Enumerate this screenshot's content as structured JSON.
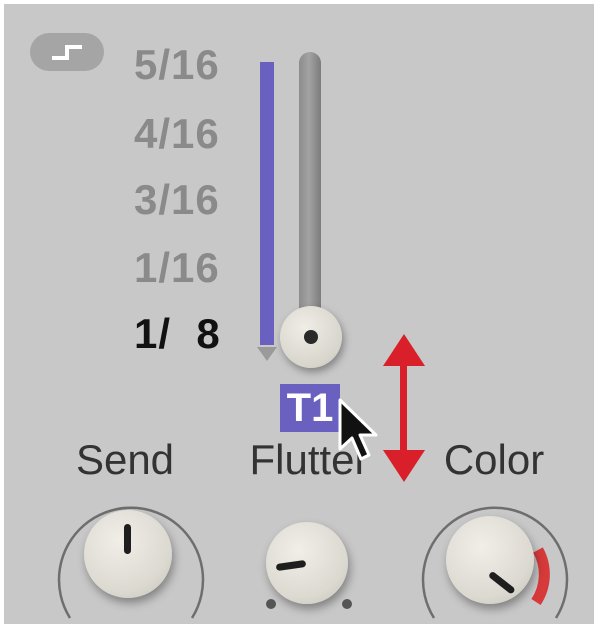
{
  "rate_selector": {
    "divisions": [
      {
        "label": "5/16",
        "active": false
      },
      {
        "label": "4/16",
        "active": false
      },
      {
        "label": "3/16",
        "active": false
      },
      {
        "label": "1/16",
        "active": false
      },
      {
        "label": "1/  8",
        "active": true
      }
    ],
    "step_icon": "step-function-icon",
    "badge_label": "T1"
  },
  "knobs": {
    "send": {
      "label": "Send"
    },
    "flutter": {
      "label": "Flutter"
    },
    "color": {
      "label": "Color"
    }
  },
  "colors": {
    "panel": "#c8c8c8",
    "accent_purple": "#6a60c0",
    "arrow_red": "#d9202a",
    "modulation_red": "#d63a3a"
  }
}
